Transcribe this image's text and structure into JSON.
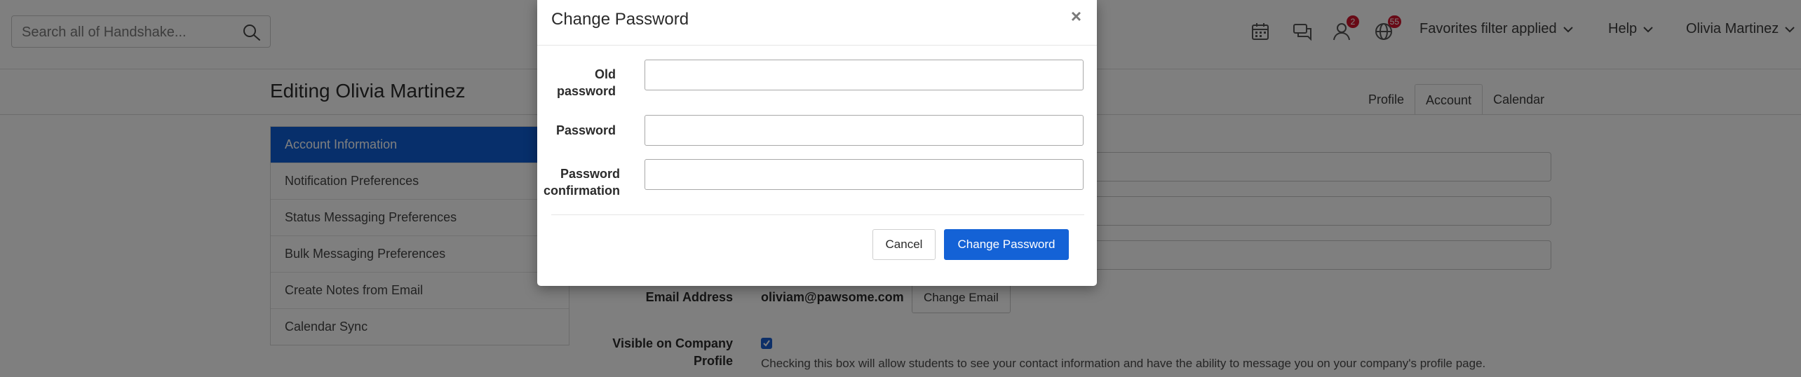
{
  "header": {
    "search": {
      "placeholder": "Search all of Handshake..."
    },
    "icons": [
      {
        "name": "calendar-icon",
        "badge": null
      },
      {
        "name": "messages-icon",
        "badge": null
      },
      {
        "name": "person-icon",
        "badge": "2"
      },
      {
        "name": "globe-icon",
        "badge": "55"
      }
    ],
    "favorites_label": "Favorites filter applied",
    "help_label": "Help",
    "user_name": "Olivia Martinez"
  },
  "page": {
    "title": "Editing Olivia Martinez",
    "tabs": [
      {
        "label": "Profile",
        "active": false
      },
      {
        "label": "Account",
        "active": true
      },
      {
        "label": "Calendar",
        "active": false
      }
    ],
    "sidebar": {
      "items": [
        {
          "label": "Account Information",
          "active": true
        },
        {
          "label": "Notification Preferences",
          "active": false
        },
        {
          "label": "Status Messaging Preferences",
          "active": false
        },
        {
          "label": "Bulk Messaging Preferences",
          "active": false
        },
        {
          "label": "Create Notes from Email",
          "active": false
        },
        {
          "label": "Calendar Sync",
          "active": false
        }
      ]
    },
    "account": {
      "email_label": "Email Address",
      "email_value": "oliviam@pawsome.com",
      "change_email_label": "Change Email",
      "visible_label_line1": "Visible on Company",
      "visible_label_line2": "Profile",
      "visible_checked": true,
      "visible_help": "Checking this box will allow students to see your contact information and have the ability to message you on your company's profile page."
    }
  },
  "modal": {
    "title": "Change Password",
    "close_symbol": "×",
    "fields": {
      "old_password": {
        "label_line1": "Old",
        "label_line2": "password",
        "value": ""
      },
      "password": {
        "label": "Password",
        "value": ""
      },
      "confirmation": {
        "label_line1": "Password",
        "label_line2": "confirmation",
        "value": ""
      }
    },
    "cancel_label": "Cancel",
    "submit_label": "Change Password"
  },
  "colors": {
    "primary": "#1462d6",
    "badge": "#d0142c",
    "overlay": "rgba(0,0,0,0.5)"
  }
}
